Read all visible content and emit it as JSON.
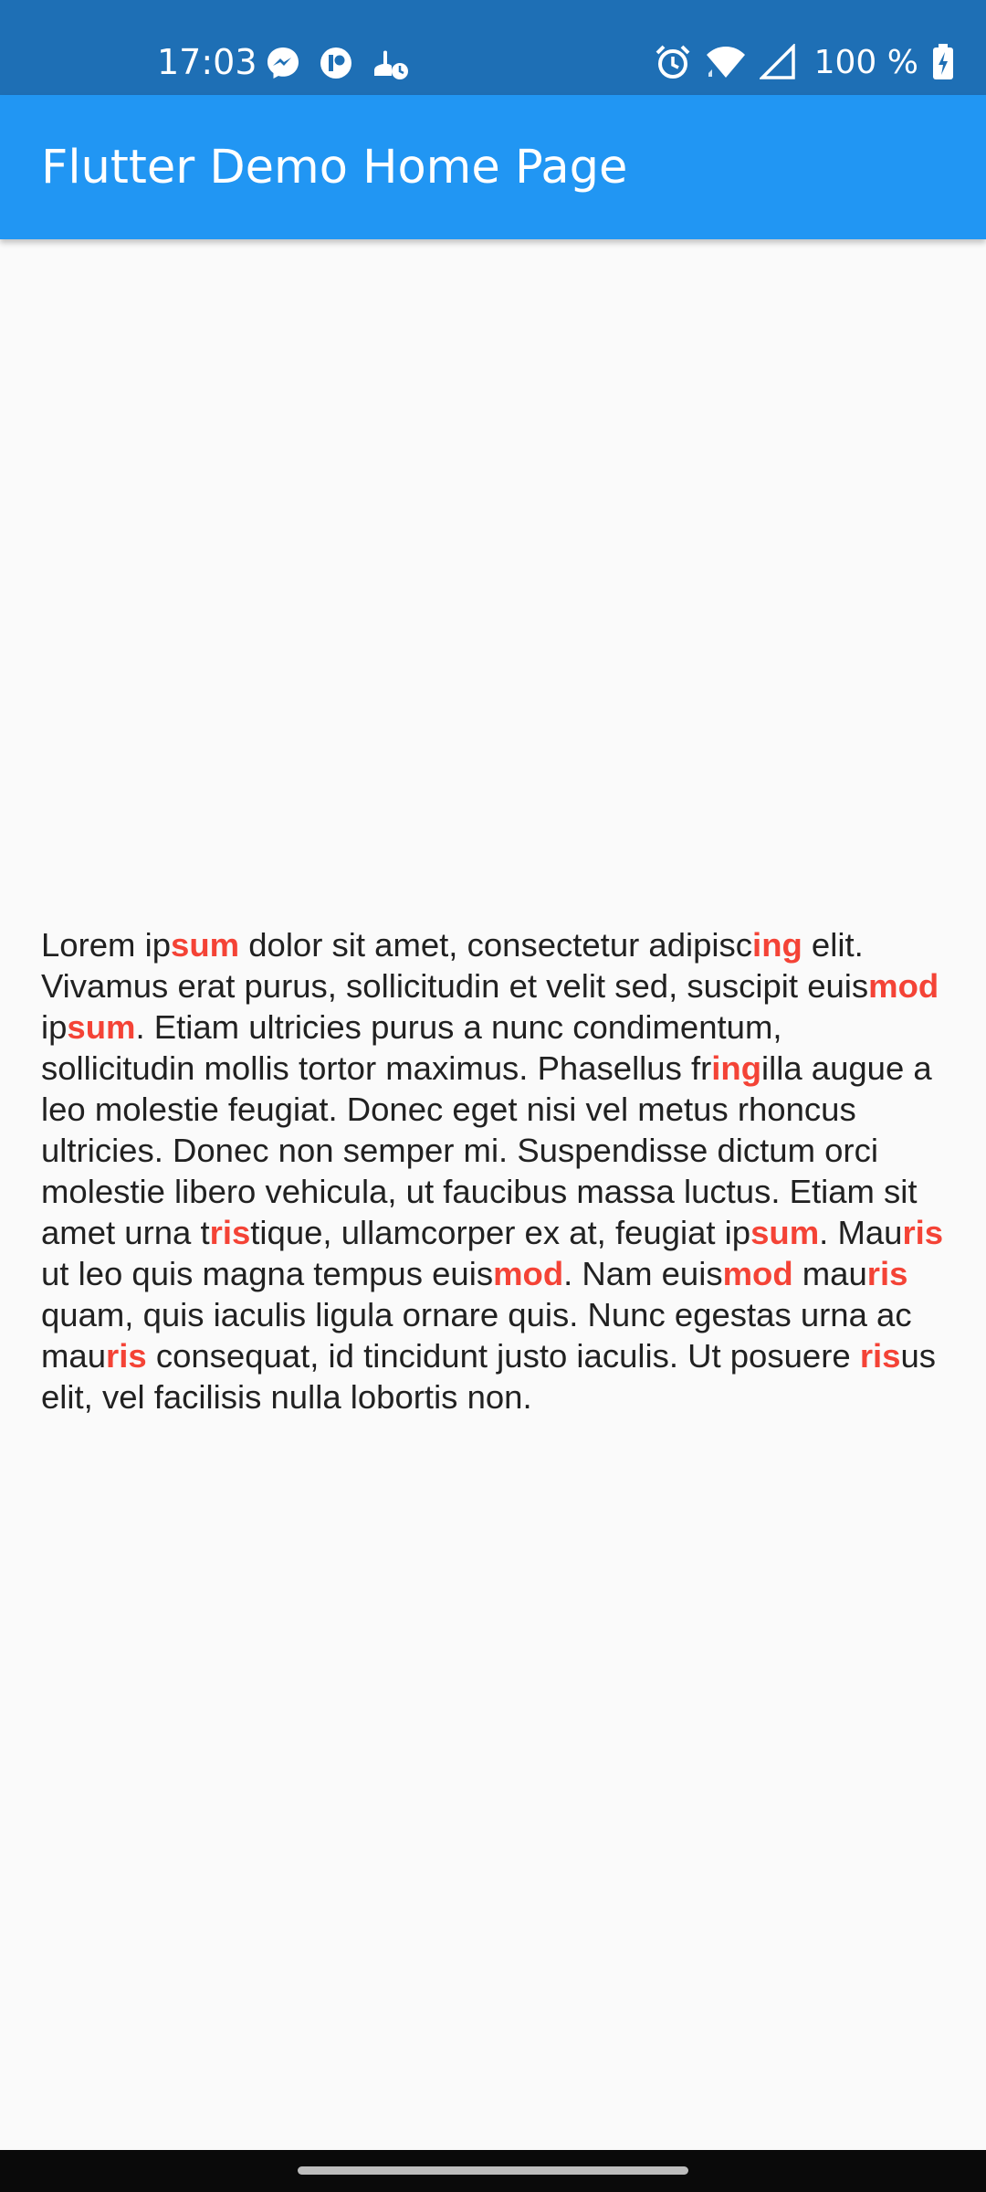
{
  "status_bar": {
    "time": "17:03",
    "battery": "100 %",
    "left_icons": [
      "messenger-icon",
      "app-icon",
      "background-task-icon"
    ],
    "right_icons": [
      "alarm-icon",
      "wifi-icon",
      "cell-signal-icon",
      "battery-charging-icon"
    ],
    "background_color": "#1e6fb5"
  },
  "app_bar": {
    "title": "Flutter Demo Home Page",
    "background_color": "#2196f3"
  },
  "content": {
    "highlight_color": "#f44336",
    "text_color": "#212121",
    "segments": [
      {
        "text": "Lorem ip",
        "hl": false
      },
      {
        "text": "sum",
        "hl": true
      },
      {
        "text": " dolor sit amet, consectetur adipisc",
        "hl": false
      },
      {
        "text": "ing",
        "hl": true
      },
      {
        "text": " elit. Vivamus erat purus, sollicitudin et velit sed, suscipit euis",
        "hl": false
      },
      {
        "text": "mod",
        "hl": true
      },
      {
        "text": " ip",
        "hl": false
      },
      {
        "text": "sum",
        "hl": true
      },
      {
        "text": ". Etiam ultricies purus a nunc condimentum, sollicitudin mollis tortor maximus. Phasellus fr",
        "hl": false
      },
      {
        "text": "ing",
        "hl": true
      },
      {
        "text": "illa augue a leo molestie feugiat. Donec eget nisi vel metus rhoncus ultricies. Donec non semper mi. Suspendisse dictum orci molestie libero vehicula, ut faucibus massa luctus. Etiam sit amet urna t",
        "hl": false
      },
      {
        "text": "ris",
        "hl": true
      },
      {
        "text": "tique, ullamcorper ex at, feugiat ip",
        "hl": false
      },
      {
        "text": "sum",
        "hl": true
      },
      {
        "text": ". Mau",
        "hl": false
      },
      {
        "text": "ris",
        "hl": true
      },
      {
        "text": " ut leo quis magna tempus euis",
        "hl": false
      },
      {
        "text": "mod",
        "hl": true
      },
      {
        "text": ". Nam euis",
        "hl": false
      },
      {
        "text": "mod",
        "hl": true
      },
      {
        "text": " mau",
        "hl": false
      },
      {
        "text": "ris",
        "hl": true
      },
      {
        "text": " quam, quis iaculis ligula ornare quis. Nunc egestas urna ac mau",
        "hl": false
      },
      {
        "text": "ris",
        "hl": true
      },
      {
        "text": " consequat, id tincidunt justo iaculis. Ut posuere ",
        "hl": false
      },
      {
        "text": "ris",
        "hl": true
      },
      {
        "text": "us elit, vel facilisis nulla lobortis non.",
        "hl": false
      }
    ]
  },
  "nav_bar": {
    "handle_icon": "home-gesture-handle"
  }
}
